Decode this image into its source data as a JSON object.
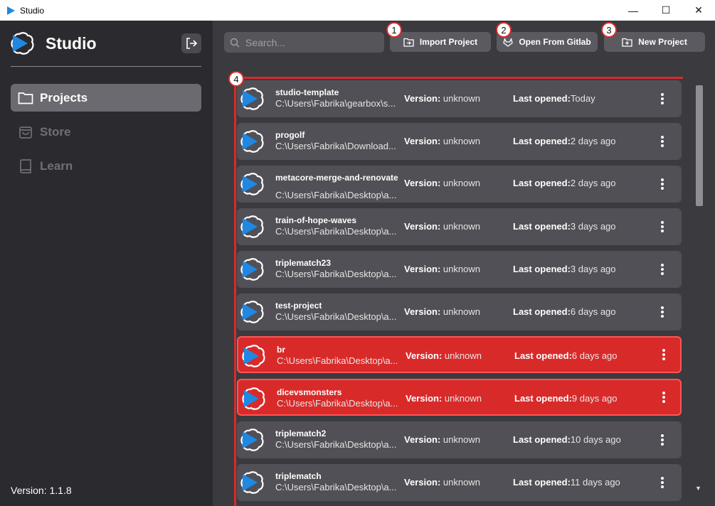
{
  "window": {
    "title": "Studio",
    "minimize": "—",
    "maximize": "☐",
    "close": "✕"
  },
  "sidebar": {
    "brand": "Studio",
    "items": [
      {
        "label": "Projects",
        "icon": "folder-icon"
      },
      {
        "label": "Store",
        "icon": "bag-icon"
      },
      {
        "label": "Learn",
        "icon": "book-icon"
      }
    ],
    "version": "Version: 1.1.8"
  },
  "toolbar": {
    "search_placeholder": "Search...",
    "import_label": "Import Project",
    "gitlab_label": "Open From Gitlab",
    "new_label": "New Project"
  },
  "callouts": [
    "1",
    "2",
    "3",
    "4"
  ],
  "projects": [
    {
      "name": "studio-template",
      "path": "C:\\Users\\Fabrika\\gearbox\\s...",
      "version_label": "Version:",
      "version": "unknown",
      "opened_label": "Last opened:",
      "opened": "Today"
    },
    {
      "name": "progolf",
      "path": "C:\\Users\\Fabrika\\Download...",
      "version_label": "Version:",
      "version": "unknown",
      "opened_label": "Last opened:",
      "opened": "2 days ago"
    },
    {
      "name": "metacore-merge-and-renovate",
      "path": "C:\\Users\\Fabrika\\Desktop\\a...",
      "version_label": "Version:",
      "version": "unknown",
      "opened_label": "Last opened:",
      "opened": "2 days ago"
    },
    {
      "name": "train-of-hope-waves",
      "path": "C:\\Users\\Fabrika\\Desktop\\a...",
      "version_label": "Version:",
      "version": "unknown",
      "opened_label": "Last opened:",
      "opened": "3 days ago"
    },
    {
      "name": "triplematch23",
      "path": "C:\\Users\\Fabrika\\Desktop\\a...",
      "version_label": "Version:",
      "version": "unknown",
      "opened_label": "Last opened:",
      "opened": "3 days ago"
    },
    {
      "name": "test-project",
      "path": "C:\\Users\\Fabrika\\Desktop\\a...",
      "version_label": "Version:",
      "version": "unknown",
      "opened_label": "Last opened:",
      "opened": "6 days ago"
    },
    {
      "name": "br",
      "path": "C:\\Users\\Fabrika\\Desktop\\a...",
      "version_label": "Version:",
      "version": "unknown",
      "opened_label": "Last opened:",
      "opened": "6 days ago",
      "highlight": true
    },
    {
      "name": "dicevsmonsters",
      "path": "C:\\Users\\Fabrika\\Desktop\\a...",
      "version_label": "Version:",
      "version": "unknown",
      "opened_label": "Last opened:",
      "opened": "9 days ago",
      "highlight": true
    },
    {
      "name": "triplematch2",
      "path": "C:\\Users\\Fabrika\\Desktop\\a...",
      "version_label": "Version:",
      "version": "unknown",
      "opened_label": "Last opened:",
      "opened": "10 days ago"
    },
    {
      "name": "triplematch",
      "path": "C:\\Users\\Fabrika\\Desktop\\a...",
      "version_label": "Version:",
      "version": "unknown",
      "opened_label": "Last opened:",
      "opened": "11 days ago"
    }
  ],
  "colors": {
    "accent": "#1e88e5",
    "sidebar": "#2b2b2f",
    "main": "#3a3a3f",
    "row": "#505056",
    "highlight": "#d92a2a"
  }
}
